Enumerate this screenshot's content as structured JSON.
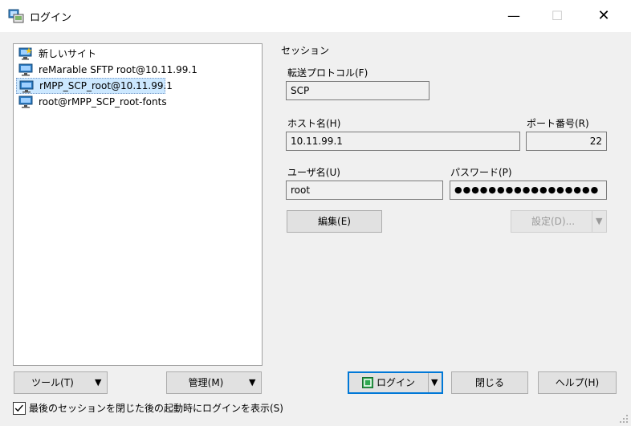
{
  "window": {
    "title": "ログイン",
    "minimize": "—",
    "maximize": "☐",
    "close": "✕"
  },
  "sites": [
    {
      "label": "新しいサイト",
      "icon": "new-site-icon"
    },
    {
      "label": "reMarable SFTP root@10.11.99.1",
      "icon": "monitor-icon"
    },
    {
      "label": "rMPP_SCP_root@10.11.99.1",
      "icon": "monitor-icon",
      "selected": true
    },
    {
      "label": "root@rMPP_SCP_root-fonts",
      "icon": "monitor-icon"
    }
  ],
  "session": {
    "group_label": "セッション",
    "protocol_label": "転送プロトコル(F)",
    "protocol_value": "SCP",
    "host_label": "ホスト名(H)",
    "host_value": "10.11.99.1",
    "port_label": "ポート番号(R)",
    "port_value": "22",
    "user_label": "ユーザ名(U)",
    "user_value": "root",
    "password_label": "パスワード(P)",
    "password_value": "●●●●●●●●●●●●●●●●●",
    "edit_button": "編集(E)",
    "settings_button": "設定(D)..."
  },
  "bottom": {
    "tools_button": "ツール(T)",
    "manage_button": "管理(M)",
    "login_button": "ログイン",
    "close_button": "閉じる",
    "help_button": "ヘルプ(H)",
    "show_login_checkbox": "最後のセッションを閉じた後の起動時にログインを表示(S)",
    "show_login_checked": true
  },
  "colors": {
    "accent": "#0078d7",
    "selection": "#cce8ff",
    "login_icon": "#2fa84f"
  }
}
